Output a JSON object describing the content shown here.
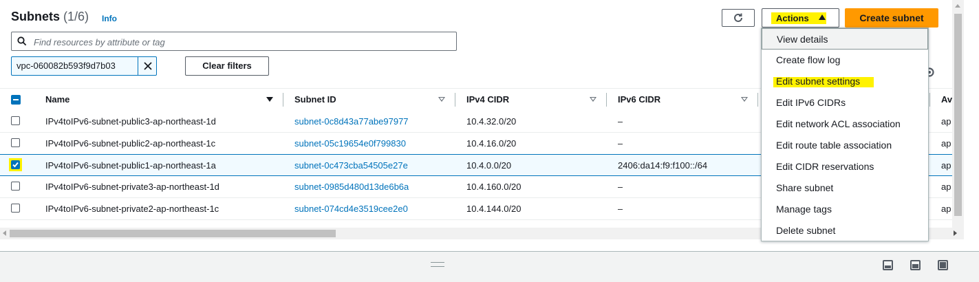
{
  "header": {
    "title": "Subnets",
    "count": "(1/6)",
    "info": "Info",
    "actions_label": "Actions",
    "create_label": "Create subnet"
  },
  "search": {
    "placeholder": "Find resources by attribute or tag"
  },
  "filter_token": {
    "label": "vpc-060082b593f9d7b03"
  },
  "clear_filters": "Clear filters",
  "table": {
    "columns": [
      "Name",
      "Subnet ID",
      "IPv4 CIDR",
      "IPv6 CIDR",
      "Av"
    ],
    "rows": [
      {
        "checked": false,
        "name": "IPv4toIPv6-subnet-public3-ap-northeast-1d",
        "subnet_id": "subnet-0c8d43a77abe97977",
        "ipv4": "10.4.32.0/20",
        "ipv6": "–",
        "az": "ap"
      },
      {
        "checked": false,
        "name": "IPv4toIPv6-subnet-public2-ap-northeast-1c",
        "subnet_id": "subnet-05c19654e0f799830",
        "ipv4": "10.4.16.0/20",
        "ipv6": "–",
        "az": "ap"
      },
      {
        "checked": true,
        "name": "IPv4toIPv6-subnet-public1-ap-northeast-1a",
        "subnet_id": "subnet-0c473cba54505e27e",
        "ipv4": "10.4.0.0/20",
        "ipv6": "2406:da14:f9:f100::/64",
        "az": "ap"
      },
      {
        "checked": false,
        "name": "IPv4toIPv6-subnet-private3-ap-northeast-1d",
        "subnet_id": "subnet-0985d480d13de6b6a",
        "ipv4": "10.4.160.0/20",
        "ipv6": "–",
        "az": "ap"
      },
      {
        "checked": false,
        "name": "IPv4toIPv6-subnet-private2-ap-northeast-1c",
        "subnet_id": "subnet-074cd4e3519cee2e0",
        "ipv4": "10.4.144.0/20",
        "ipv6": "–",
        "az": "ap"
      }
    ]
  },
  "actions_menu": {
    "items": [
      "View details",
      "Create flow log",
      "Edit subnet settings",
      "Edit IPv6 CIDRs",
      "Edit network ACL association",
      "Edit route table association",
      "Edit CIDR reservations",
      "Share subnet",
      "Manage tags",
      "Delete subnet"
    ]
  },
  "colors": {
    "primary": "#ff9900",
    "link": "#0073bb",
    "highlight": "#fff200",
    "selected_row": "#f1faff"
  },
  "icons": [
    "refresh-icon",
    "caret-up-icon",
    "search-icon",
    "close-icon",
    "gear-icon",
    "sort-down-icon",
    "drag-handle-icon",
    "split-panel-icons"
  ]
}
